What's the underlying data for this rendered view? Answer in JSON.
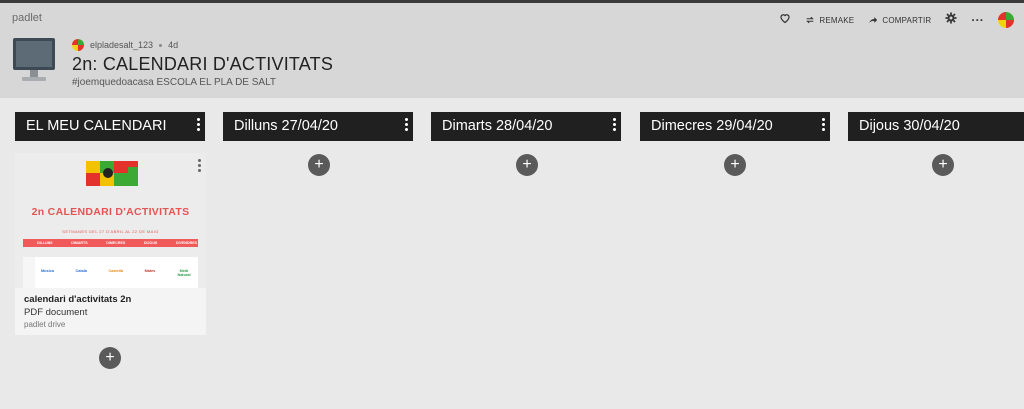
{
  "app": {
    "brand": "padlet"
  },
  "toolbar": {
    "remake_label": "REMAKE",
    "share_label": "COMPARTIR",
    "more_label": "···"
  },
  "board": {
    "author": "elpladesalt_123",
    "age": "4d",
    "title": "2n: CALENDARI D'ACTIVITATS",
    "subtitle": "#joemquedoacasa ESCOLA EL PLA DE SALT"
  },
  "columns": [
    {
      "label": "EL MEU CALENDARI"
    },
    {
      "label": "Dilluns 27/04/20"
    },
    {
      "label": "Dimarts 28/04/20"
    },
    {
      "label": "Dimecres 29/04/20"
    },
    {
      "label": "Dijous 30/04/20"
    }
  ],
  "add_label": "+",
  "card": {
    "title": "calendari d'activitats 2n",
    "type": "PDF document",
    "source": "padlet drive",
    "thumbnail": {
      "heading": "2n CALENDARI D'ACTIVITATS",
      "subheading": "SETMANES DEL 27 D'ABRIL AL 22 DE MAIG",
      "days": [
        "DILLUNS",
        "DIMARTS",
        "DIMECRES",
        "DIJOUS",
        "DIVENDRES"
      ],
      "subjects": [
        "Música",
        "Català",
        "Castellà",
        "Mates",
        "Medi Natural"
      ]
    }
  },
  "colors": {
    "header_bg": "#d7d7d7",
    "board_bg": "#e9e9e9",
    "column_head_bg": "#202020",
    "accent_red": "#f05a5a"
  }
}
